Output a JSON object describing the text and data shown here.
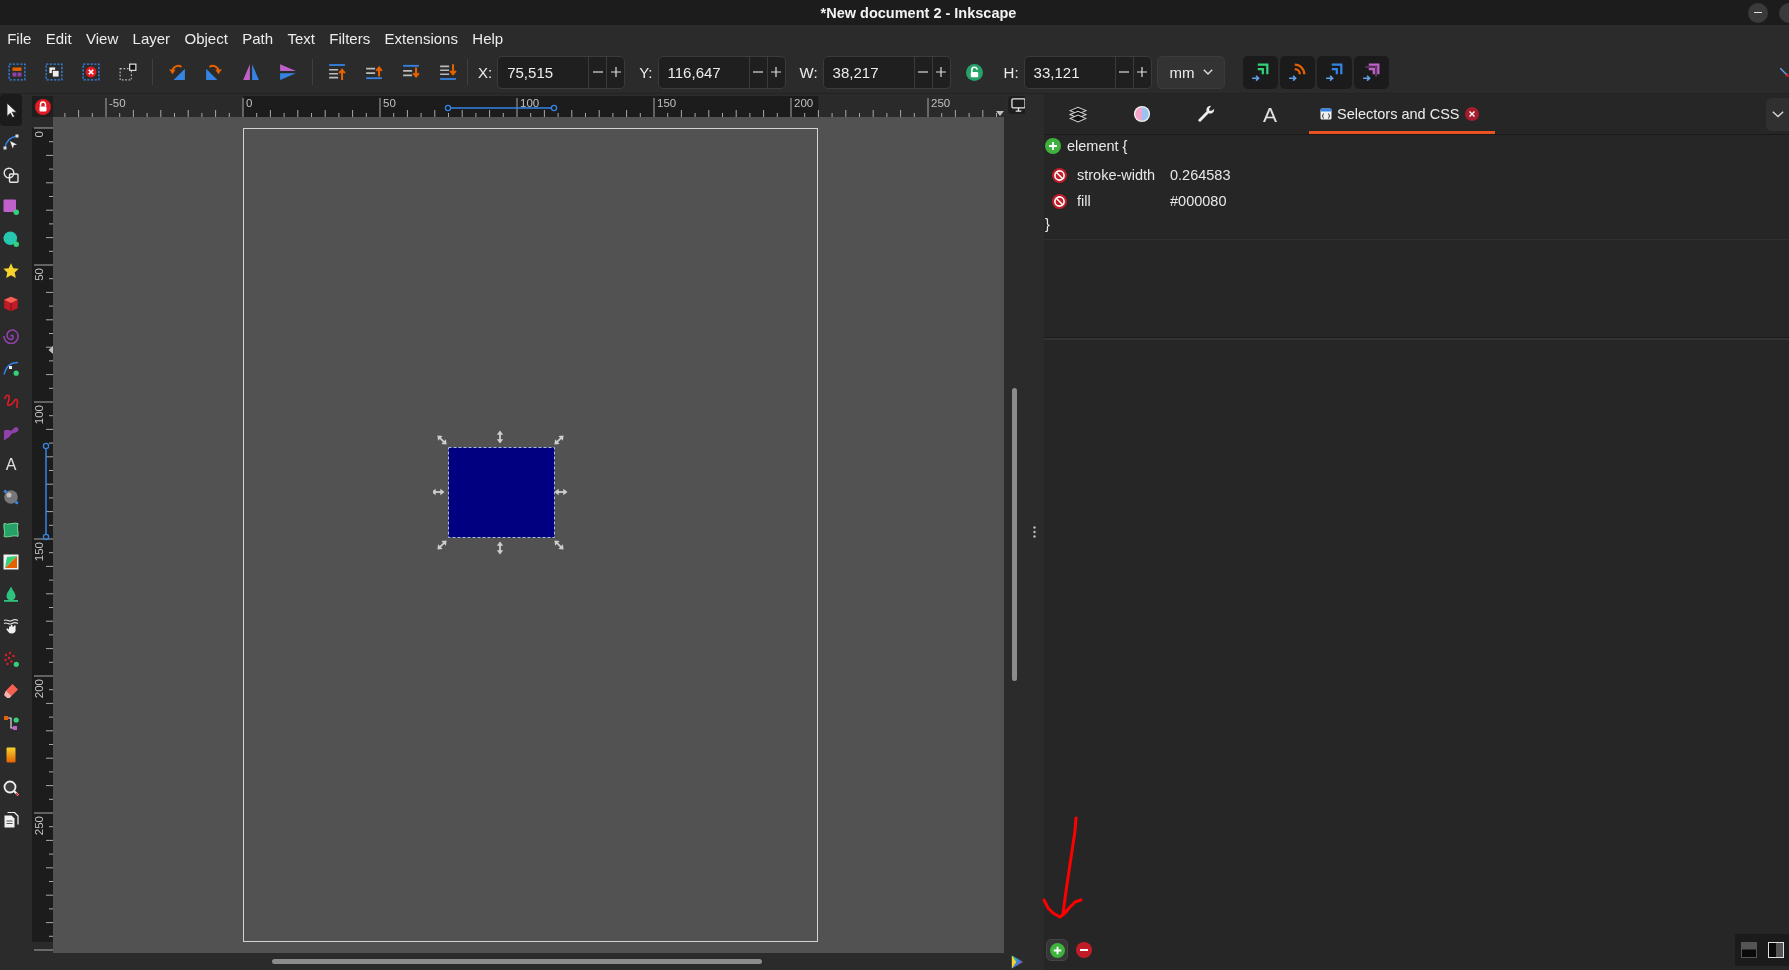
{
  "window": {
    "title": "*New document 2 - Inkscape"
  },
  "menu": [
    "File",
    "Edit",
    "View",
    "Layer",
    "Object",
    "Path",
    "Text",
    "Filters",
    "Extensions",
    "Help"
  ],
  "toolbar": {
    "items": [
      {
        "kind": "field",
        "label": "X:",
        "value": "75,515"
      },
      {
        "kind": "field",
        "label": "Y:",
        "value": "116,647"
      },
      {
        "kind": "field",
        "label": "W:",
        "value": "38,217"
      },
      {
        "kind": "lock",
        "locked": false
      },
      {
        "kind": "field",
        "label": "H:",
        "value": "33,121"
      },
      {
        "kind": "unit",
        "value": "mm"
      }
    ]
  },
  "toolbox": [
    {
      "selected": true
    },
    {
      "selected": false
    },
    {
      "selected": false
    },
    {
      "selected": false
    },
    {
      "selected": false
    },
    {
      "selected": false
    },
    {
      "selected": false
    },
    {
      "selected": false
    },
    {
      "selected": false
    },
    {
      "selected": false
    },
    {
      "selected": false
    },
    {
      "glyph": "A",
      "selected": false
    },
    {
      "selected": false
    },
    {
      "selected": false
    },
    {
      "selected": false
    },
    {
      "selected": false
    },
    {
      "selected": false
    },
    {
      "selected": false
    },
    {
      "selected": false
    },
    {
      "selected": false
    },
    {
      "selected": false
    },
    {
      "selected": false
    },
    {
      "selected": false
    }
  ],
  "rulers": {
    "horizontal": [
      "-50",
      "0",
      "50",
      "100",
      "150",
      "200",
      "250"
    ],
    "vertical": [
      "0",
      "50",
      "100",
      "150",
      "200",
      "250"
    ]
  },
  "dock": {
    "tabs": [
      {
        "selected": false
      },
      {
        "selected": false
      },
      {
        "selected": false
      },
      {
        "glyph": "A",
        "selected": false
      },
      {
        "label": "Selectors and CSS",
        "selected": true
      }
    ],
    "rule": {
      "selector": "element",
      "open": "{",
      "close": "}",
      "properties": [
        {
          "name": "stroke-width",
          "value": "0.264583"
        },
        {
          "name": "fill",
          "value": "#000080"
        }
      ]
    }
  }
}
